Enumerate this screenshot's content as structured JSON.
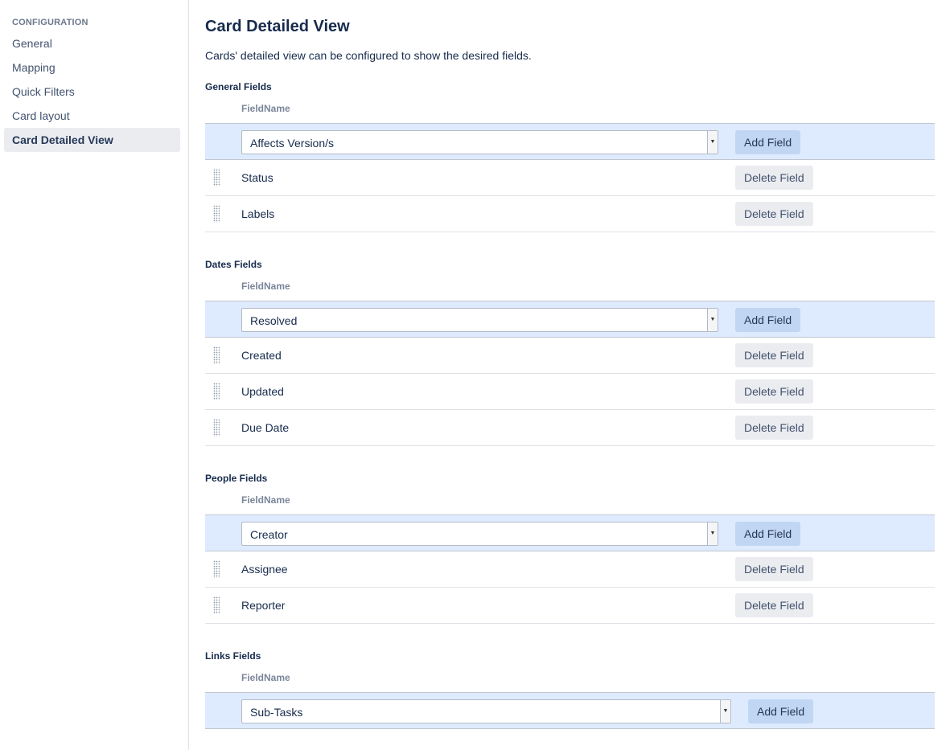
{
  "sidebar": {
    "heading": "CONFIGURATION",
    "items": [
      {
        "label": "General"
      },
      {
        "label": "Mapping"
      },
      {
        "label": "Quick Filters"
      },
      {
        "label": "Card layout"
      },
      {
        "label": "Card Detailed View",
        "active": true
      }
    ]
  },
  "main": {
    "title": "Card Detailed View",
    "description": "Cards' detailed view can be configured to show the desired fields.",
    "sections": [
      {
        "title": "General Fields",
        "column_header": "FieldName",
        "select_value": "Affects Version/s",
        "add_label": "Add Field",
        "rows": [
          {
            "name": "Status",
            "delete_label": "Delete Field"
          },
          {
            "name": "Labels",
            "delete_label": "Delete Field"
          }
        ]
      },
      {
        "title": "Dates Fields",
        "column_header": "FieldName",
        "select_value": "Resolved",
        "add_label": "Add Field",
        "rows": [
          {
            "name": "Created",
            "delete_label": "Delete Field"
          },
          {
            "name": "Updated",
            "delete_label": "Delete Field"
          },
          {
            "name": "Due Date",
            "delete_label": "Delete Field"
          }
        ]
      },
      {
        "title": "People Fields",
        "column_header": "FieldName",
        "select_value": "Creator",
        "add_label": "Add Field",
        "rows": [
          {
            "name": "Assignee",
            "delete_label": "Delete Field"
          },
          {
            "name": "Reporter",
            "delete_label": "Delete Field"
          }
        ]
      },
      {
        "title": "Links Fields",
        "column_header": "FieldName",
        "select_value": "Sub-Tasks",
        "add_label": "Add Field",
        "rows": []
      }
    ]
  },
  "colors": {
    "accent_row": "#deebff",
    "sidebar_active": "#ebecf0",
    "text": "#172b4d"
  }
}
